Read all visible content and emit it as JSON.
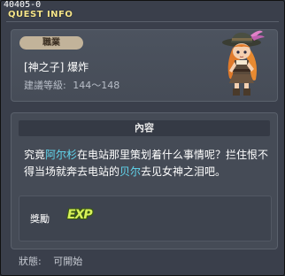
{
  "quest_id": "40405-0",
  "title": "QUEST INFO",
  "header": {
    "job_badge": "職業",
    "quest_name": "[神之子] 爆炸",
    "level_label": "建議等級:",
    "level_range": "144～148"
  },
  "content": {
    "section_title": "內容",
    "text_parts": [
      "究竟",
      "阿尔杉",
      "在电站那里策划着什么事情呢？拦住恨不得当场就奔去电站的",
      "贝尔",
      "去见女神之泪吧。"
    ]
  },
  "reward": {
    "label": "獎勵",
    "exp_text": "EXP"
  },
  "status": {
    "label": "狀態:",
    "value": "可開始"
  },
  "colors": {
    "title": "#f6e58a",
    "npc_highlight": "#62d8f0",
    "exp": "#d8f25a",
    "background": "#3a3f4b"
  }
}
